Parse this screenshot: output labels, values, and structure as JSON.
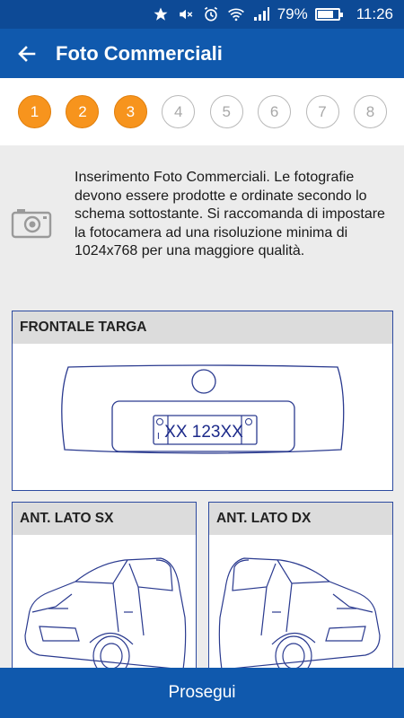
{
  "status_bar": {
    "battery": "79%",
    "time": "11:26",
    "battery_level": 0.79,
    "icons": [
      "star-icon",
      "mute-icon",
      "alarm-icon",
      "wifi-icon",
      "signal-icon",
      "battery-icon"
    ]
  },
  "app_bar": {
    "title": "Foto Commerciali",
    "back_icon": "arrow-left-icon"
  },
  "stepper": {
    "steps": [
      {
        "label": "1",
        "state": "done"
      },
      {
        "label": "2",
        "state": "done"
      },
      {
        "label": "3",
        "state": "done"
      },
      {
        "label": "4",
        "state": "pending"
      },
      {
        "label": "5",
        "state": "pending"
      },
      {
        "label": "6",
        "state": "pending"
      },
      {
        "label": "7",
        "state": "pending"
      },
      {
        "label": "8",
        "state": "pending"
      }
    ],
    "colors": {
      "done": "#f7941d",
      "pending": "#b9b9b9"
    }
  },
  "intro": {
    "icon": "camera-icon",
    "text": "Inserimento Foto Commerciali. Le fotografie devono essere prodotte e ordinate secondo lo schema sottostante. Si raccomanda di impostare la fotocamera ad una risoluzione minima di 1024x768 per una maggiore qualità."
  },
  "photos": {
    "front": {
      "title": "FRONTALE TARGA",
      "plate_text": "XX 123XX",
      "plate_prefix": "I"
    },
    "left": {
      "title": "ANT. LATO SX"
    },
    "right": {
      "title": "ANT. LATO DX"
    }
  },
  "footer": {
    "button_label": "Prosegui"
  },
  "colors": {
    "status_bar": "#0d4a96",
    "app_bar": "#1059ad",
    "accent": "#f7941d",
    "card_border": "#2c4aa0"
  }
}
